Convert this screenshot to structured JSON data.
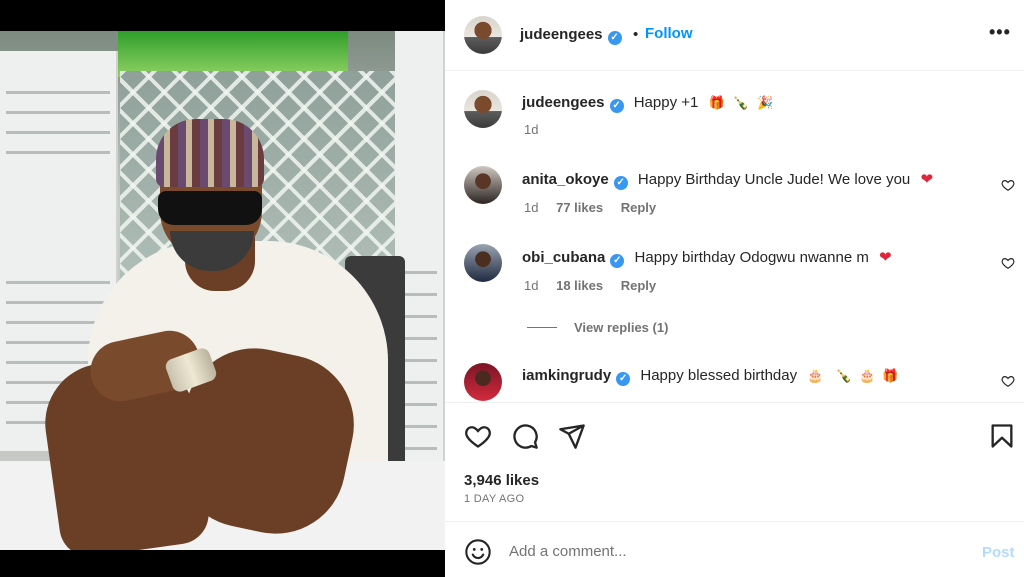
{
  "post": {
    "author": "judeengees",
    "follow_label": "Follow",
    "separator": "•",
    "more_label": "•••"
  },
  "caption": {
    "username": "judeengees",
    "text": "Happy +1",
    "emojis": [
      "🎁",
      "🍾",
      "🎉"
    ],
    "time": "1d"
  },
  "comments": [
    {
      "username": "anita_okoye",
      "text": "Happy Birthday Uncle Jude! We love you",
      "emoji": "❤",
      "time": "1d",
      "likes": "77 likes",
      "reply": "Reply"
    },
    {
      "username": "obi_cubana",
      "text": "Happy birthday Odogwu nwanne m",
      "emoji": "❤",
      "time": "1d",
      "likes": "18 likes",
      "reply": "Reply",
      "view_replies": "View replies (1)"
    },
    {
      "username": "iamkingrudy",
      "text": "Happy blessed birthday",
      "emojis": [
        "🎂",
        "🍾",
        "🎂",
        "🎁"
      ]
    }
  ],
  "stats": {
    "likes": "3,946 likes",
    "date": "1 DAY AGO"
  },
  "add_comment": {
    "placeholder": "Add a comment...",
    "post_label": "Post"
  },
  "icons": {
    "verified": "verified-badge-icon",
    "like": "heart-icon",
    "comment": "comment-icon",
    "share": "share-icon",
    "save": "bookmark-icon",
    "emoji": "emoji-icon",
    "more": "more-options-icon"
  },
  "colors": {
    "accent": "#0095f6",
    "verified": "#3897f0",
    "muted": "#737373",
    "post_disabled": "#b3dbff",
    "heart": "#e0263c"
  }
}
